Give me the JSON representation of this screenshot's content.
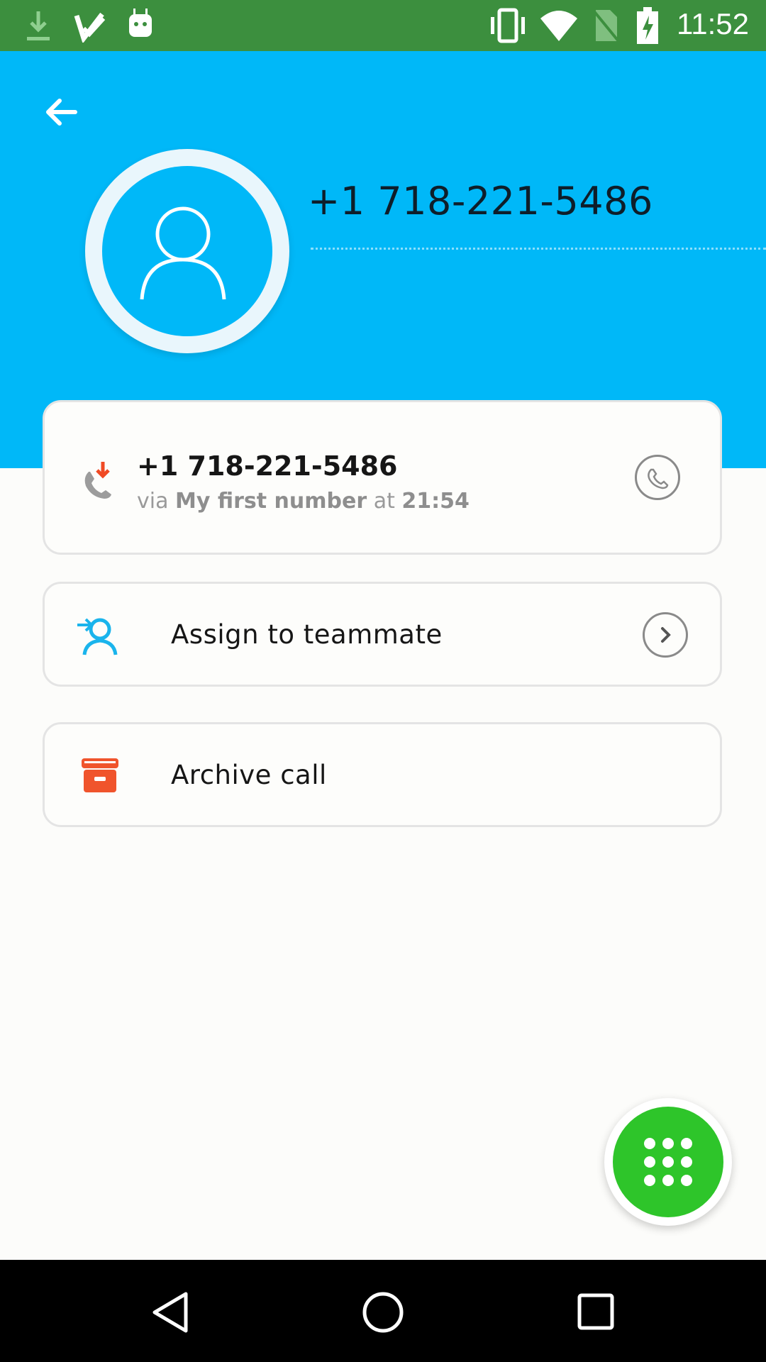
{
  "status_bar": {
    "time": "11:52",
    "icons": [
      "download-icon",
      "check-notification-icon",
      "android-debug-icon",
      "vibrate-icon",
      "wifi-icon",
      "no-sim-icon",
      "battery-charging-icon"
    ]
  },
  "header": {
    "back_icon": "arrow-left-icon",
    "avatar_icon": "person-icon",
    "contact_name": "+1 718-221-5486"
  },
  "call_card": {
    "icon": "incoming-call-icon",
    "number": "+1 718-221-5486",
    "via_word": "via",
    "line_name": "My first number",
    "at_word": "at",
    "time": "21:54",
    "call_button_icon": "phone-icon"
  },
  "assign_card": {
    "icon": "assign-user-icon",
    "label": "Assign to teammate",
    "chevron_icon": "chevron-right-icon"
  },
  "archive_card": {
    "icon": "archive-box-icon",
    "label": "Archive call"
  },
  "fab": {
    "icon": "dialpad-icon"
  },
  "nav_bar": {
    "buttons": [
      "back-nav-icon",
      "home-nav-icon",
      "recents-nav-icon"
    ]
  },
  "colors": {
    "status_bar": "#3c8f3e",
    "header": "#00b8f8",
    "fab": "#2ec52a",
    "incoming_arrow": "#f04a24",
    "assign_icon": "#1ab4ec",
    "archive_icon": "#f0542c"
  }
}
